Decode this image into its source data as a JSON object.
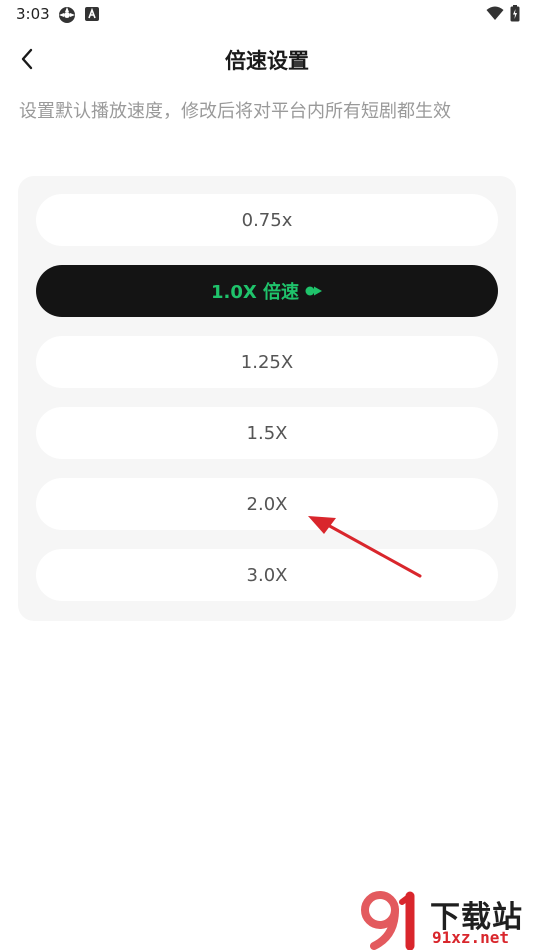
{
  "status_bar": {
    "time": "3:03"
  },
  "header": {
    "title": "倍速设置"
  },
  "description": "设置默认播放速度，修改后将对平台内所有短剧都生效",
  "options": [
    {
      "label": "0.75x",
      "selected": false
    },
    {
      "label": "1.0X 倍速",
      "selected": true
    },
    {
      "label": "1.25X",
      "selected": false
    },
    {
      "label": "1.5X",
      "selected": false
    },
    {
      "label": "2.0X",
      "selected": false
    },
    {
      "label": "3.0X",
      "selected": false
    }
  ],
  "watermark": {
    "cn_text": "下载站",
    "en_text": "91xz.net"
  },
  "colors": {
    "accent_green": "#1fc36b",
    "selected_bg": "#141414",
    "panel_bg": "#f6f6f6",
    "arrow_red": "#d9262c"
  }
}
